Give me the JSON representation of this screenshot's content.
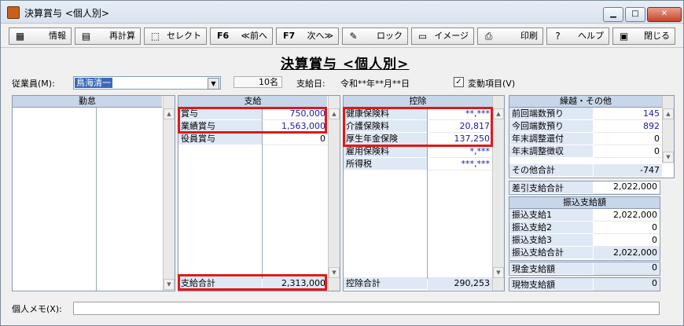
{
  "window": {
    "title": "決算賞与 <個人別>"
  },
  "toolbar": [
    {
      "key": "",
      "label": "情報",
      "icon": "info-icon",
      "glyph": "▦"
    },
    {
      "key": "",
      "label": "再計算",
      "icon": "recalc-icon",
      "glyph": "▤"
    },
    {
      "key": "",
      "label": "セレクト",
      "icon": "select-icon",
      "glyph": "⬚"
    },
    {
      "key": "F6",
      "label": "≪前へ",
      "icon": "",
      "glyph": ""
    },
    {
      "key": "F7",
      "label": "次へ≫",
      "icon": "",
      "glyph": ""
    },
    {
      "key": "",
      "label": "ロック",
      "icon": "lock-icon",
      "glyph": "✎"
    },
    {
      "key": "",
      "label": "イメージ",
      "icon": "image-icon",
      "glyph": "▭"
    },
    {
      "key": "",
      "label": "印刷",
      "icon": "print-icon",
      "glyph": "⎙"
    },
    {
      "key": "",
      "label": "ヘルプ",
      "icon": "help-icon",
      "glyph": "?"
    },
    {
      "key": "",
      "label": "閉じる",
      "icon": "close-door-icon",
      "glyph": "▣"
    }
  ],
  "page_title": "決算賞与 <個人別>",
  "header": {
    "employee_label": "従業員(M):",
    "employee_value": "鳥海清一",
    "count": "10名",
    "pay_date_label": "支給日:",
    "pay_date_value": "令和**年**月**日",
    "variable_items_label": "変動項目(V)",
    "variable_items_checked": "✓"
  },
  "attendance": {
    "title": "勤怠"
  },
  "payment": {
    "title": "支給",
    "rows": [
      {
        "label": "賞与",
        "value": "750,000"
      },
      {
        "label": "業績賞与",
        "value": "1,563,000"
      },
      {
        "label": "役員賞与",
        "value": "0"
      }
    ],
    "total_label": "支給合計",
    "total_value": "2,313,000"
  },
  "deduction": {
    "title": "控除",
    "rows": [
      {
        "label": "健康保険料",
        "value": "**,***"
      },
      {
        "label": "介護保険料",
        "value": "20,817"
      },
      {
        "label": "厚生年金保険",
        "value": "137,250"
      },
      {
        "label": "雇用保険料",
        "value": "*,***"
      },
      {
        "label": "所得税",
        "value": "***,***"
      }
    ],
    "total_label": "控除合計",
    "total_value": "290,253"
  },
  "carryover": {
    "title": "繰越・その他",
    "rows": [
      {
        "label": "前回端数預り",
        "value": "145"
      },
      {
        "label": "今回端数預り",
        "value": "892"
      },
      {
        "label": "年末調整還付",
        "value": "0"
      },
      {
        "label": "年末調整徴収",
        "value": "0"
      }
    ],
    "other_total_label": "その他合計",
    "other_total_value": "-747"
  },
  "net_pay": {
    "label": "差引支給合計",
    "value": "2,022,000"
  },
  "transfer": {
    "title": "振込支給額",
    "rows": [
      {
        "label": "振込支給1",
        "value": "2,022,000"
      },
      {
        "label": "振込支給2",
        "value": "0"
      },
      {
        "label": "振込支給3",
        "value": "0"
      },
      {
        "label": "振込支給合計",
        "value": "2,022,000"
      }
    ]
  },
  "cash_pay": {
    "label": "現金支給額",
    "value": "0"
  },
  "goods_pay": {
    "label": "現物支給額",
    "value": "0"
  },
  "memo": {
    "label": "個人メモ(X):",
    "value": ""
  }
}
